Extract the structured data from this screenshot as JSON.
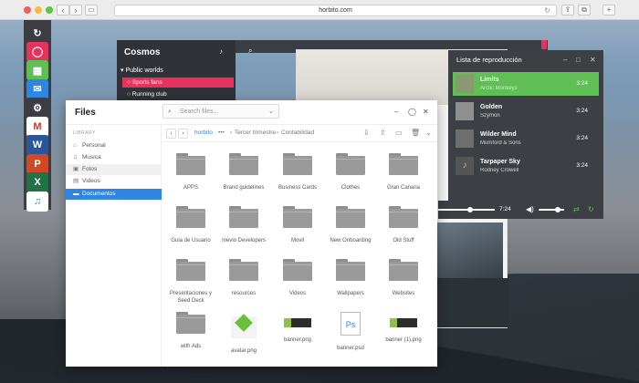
{
  "browser": {
    "url": "horbito.com",
    "colors": {
      "close": "#ee5f58",
      "minimize": "#f6bd3b",
      "zoom": "#5fc43f"
    }
  },
  "dock": {
    "items": [
      {
        "name": "sync-app-icon",
        "color": "#3b3d42",
        "glyph": "↻"
      },
      {
        "name": "cosmos-app-icon",
        "color": "#e8315c",
        "glyph": "◯"
      },
      {
        "name": "calendar-app-icon",
        "color": "#5fbf55",
        "glyph": "▦"
      },
      {
        "name": "chat-app-icon",
        "color": "#2f86e0",
        "glyph": "✉"
      },
      {
        "name": "settings-app-icon",
        "color": "#3b3d42",
        "glyph": "⚙"
      },
      {
        "name": "gmail-app-icon",
        "color": "#ffffff",
        "glyph": "M"
      },
      {
        "name": "word-app-icon",
        "color": "#2b579a",
        "glyph": "W"
      },
      {
        "name": "powerpoint-app-icon",
        "color": "#d24726",
        "glyph": "P"
      },
      {
        "name": "excel-app-icon",
        "color": "#217346",
        "glyph": "X"
      },
      {
        "name": "music-app-icon",
        "color": "#ffffff",
        "glyph": "♫"
      }
    ]
  },
  "cosmos": {
    "title": "Cosmos",
    "section": "Public worlds",
    "items": [
      {
        "label": "Sports fans",
        "active": true
      },
      {
        "label": "Running club",
        "active": false
      }
    ]
  },
  "music": {
    "title": "Lista de reproducción",
    "tracks": [
      {
        "name": "Limits",
        "artist": "Arctic Monkeys",
        "duration": "3:24",
        "active": true
      },
      {
        "name": "Golden",
        "artist": "Szymon",
        "duration": "3:24",
        "active": false
      },
      {
        "name": "Wilder Mind",
        "artist": "Mumford & Sons",
        "duration": "3:24",
        "active": false
      },
      {
        "name": "Tarpaper Sky",
        "artist": "Rodney Crowell",
        "duration": "3:24",
        "active": false
      }
    ],
    "player": {
      "time": "7:24",
      "progress": 0.55,
      "volume": 0.7
    },
    "accent": "#5fbf55"
  },
  "files": {
    "title": "Files",
    "search_placeholder": "Search files...",
    "sidebar": {
      "library_label": "LIBRARY",
      "items": [
        {
          "label": "Personal",
          "icon": "home-icon",
          "state": "normal"
        },
        {
          "label": "Musica",
          "icon": "music-icon",
          "state": "normal"
        },
        {
          "label": "Fotos",
          "icon": "photo-icon",
          "state": "hover"
        },
        {
          "label": "Videos",
          "icon": "video-icon",
          "state": "normal"
        },
        {
          "label": "Documentos",
          "icon": "document-icon",
          "state": "active"
        }
      ]
    },
    "breadcrumb": {
      "root": "horbito",
      "ellipsis": "•••",
      "parent": "Tercer trimestre",
      "current": "Contabilidad"
    },
    "items": [
      {
        "label": "APPS",
        "type": "folder"
      },
      {
        "label": "Brand guidelines",
        "type": "folder"
      },
      {
        "label": "Business Cards",
        "type": "folder"
      },
      {
        "label": "Clothes",
        "type": "folder"
      },
      {
        "label": "Gran Canaria",
        "type": "folder"
      },
      {
        "label": "Guia de Usuario",
        "type": "folder"
      },
      {
        "label": "Inevio Developers",
        "type": "folder"
      },
      {
        "label": "Movil",
        "type": "folder"
      },
      {
        "label": "New Onboarding",
        "type": "folder"
      },
      {
        "label": "Old Stuff",
        "type": "folder"
      },
      {
        "label": "Presentaciones y Seed Deck",
        "type": "folder"
      },
      {
        "label": "resources",
        "type": "folder"
      },
      {
        "label": "Videos",
        "type": "folder"
      },
      {
        "label": "Wallpapers",
        "type": "folder"
      },
      {
        "label": "Websites",
        "type": "folder"
      },
      {
        "label": "with Ads",
        "type": "folder"
      },
      {
        "label": "avatar.png",
        "type": "image-green"
      },
      {
        "label": "banner.png",
        "type": "image-banner"
      },
      {
        "label": "banner.psd",
        "type": "psd"
      },
      {
        "label": "banner (1).png",
        "type": "image-banner"
      }
    ]
  }
}
